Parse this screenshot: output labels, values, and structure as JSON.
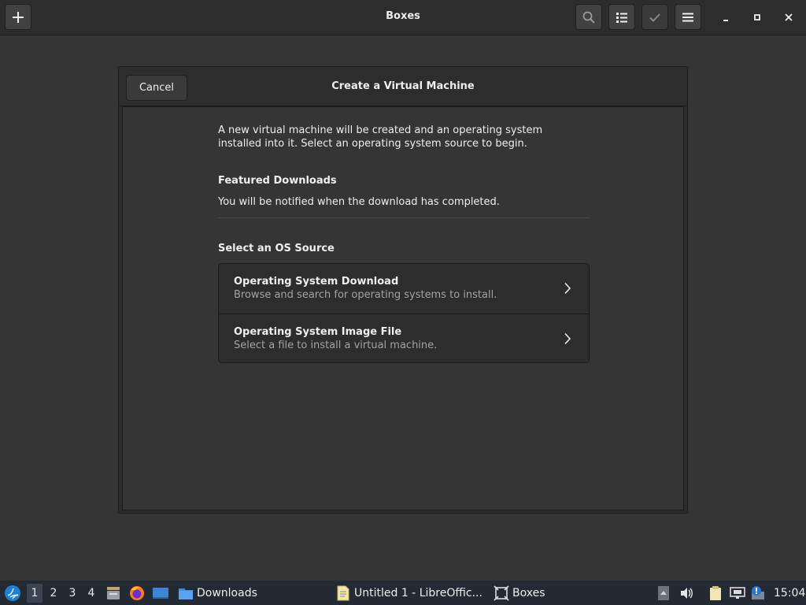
{
  "app": {
    "title": "Boxes",
    "buttons": {
      "new": "plus-icon",
      "search": "search-icon",
      "view": "list-view-icon",
      "select": "check-icon",
      "menu": "hamburger-menu-icon"
    },
    "window_controls": [
      "minimize-icon",
      "maximize-icon",
      "close-icon"
    ]
  },
  "dialog": {
    "title": "Create a Virtual Machine",
    "cancel_label": "Cancel",
    "intro_line1": "A new virtual machine will be created and an operating system",
    "intro_line2": "installed into it. Select an operating system source to begin.",
    "featured_heading": "Featured Downloads",
    "featured_note": "You will be notified when the download has completed.",
    "source_heading": "Select an OS Source",
    "sources": [
      {
        "title": "Operating System Download",
        "subtitle": "Browse and search for operating systems to install."
      },
      {
        "title": "Operating System Image File",
        "subtitle": "Select a file to install a virtual machine."
      }
    ]
  },
  "taskbar": {
    "workspaces": [
      "1",
      "2",
      "3",
      "4"
    ],
    "active_workspace": "1",
    "tasks": [
      {
        "label": "Downloads",
        "icon": "folder-icon"
      },
      {
        "label": "Untitled 1 - LibreOffic...",
        "icon": "libreoffice-writer-icon"
      },
      {
        "label": "Boxes",
        "icon": "boxes-icon"
      }
    ],
    "clock": "15:04"
  },
  "colors": {
    "window_bg": "#353535",
    "headerbar_bg": "#2d2d2d",
    "taskbar_bg": "#242a33",
    "text": "#eeeeec",
    "subtext": "#a2a2a2"
  }
}
